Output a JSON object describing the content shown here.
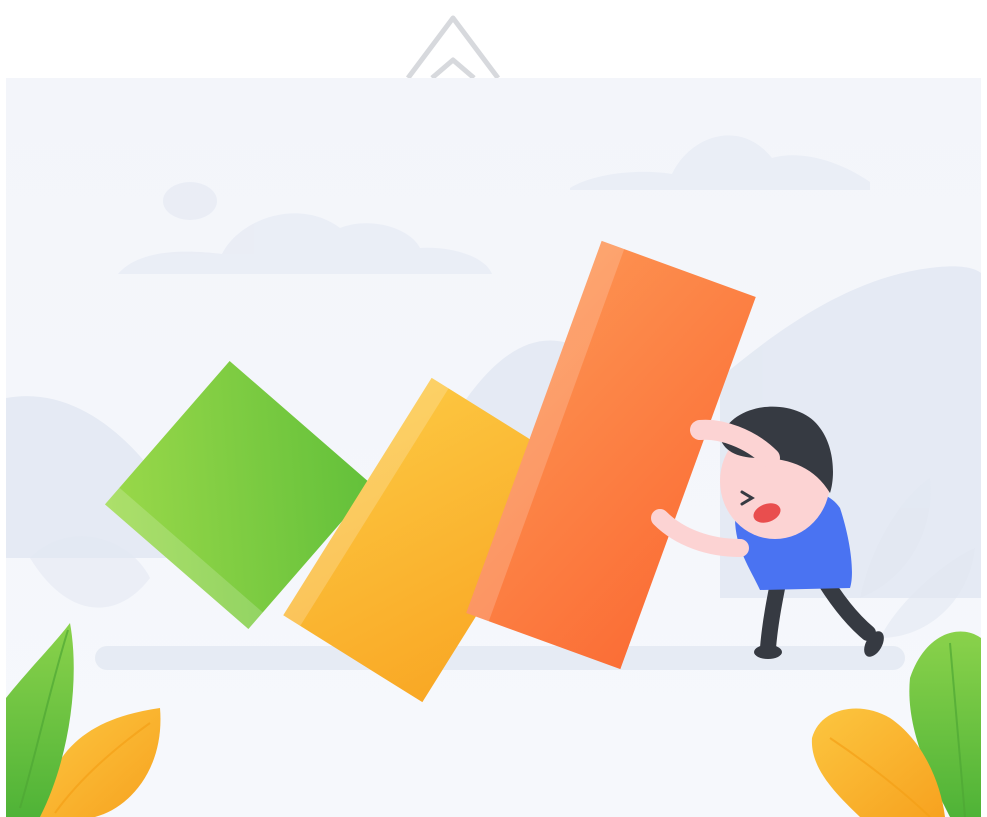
{
  "colors": {
    "background": "#f5f7fb",
    "cloud": "#e9edf5",
    "hill": "#e3e9f3",
    "green_block": "#7ccf3f",
    "yellow_block": "#fbb72c",
    "orange_block": "#fd7f3f",
    "person_shirt": "#4a73f2",
    "person_hair": "#363a42",
    "person_skin": "#fcd3d3",
    "leaf_green": "#6cc43f",
    "leaf_yellow": "#fbb72c"
  },
  "icons": {
    "top_logo": "chevron-up-outline-icon"
  }
}
